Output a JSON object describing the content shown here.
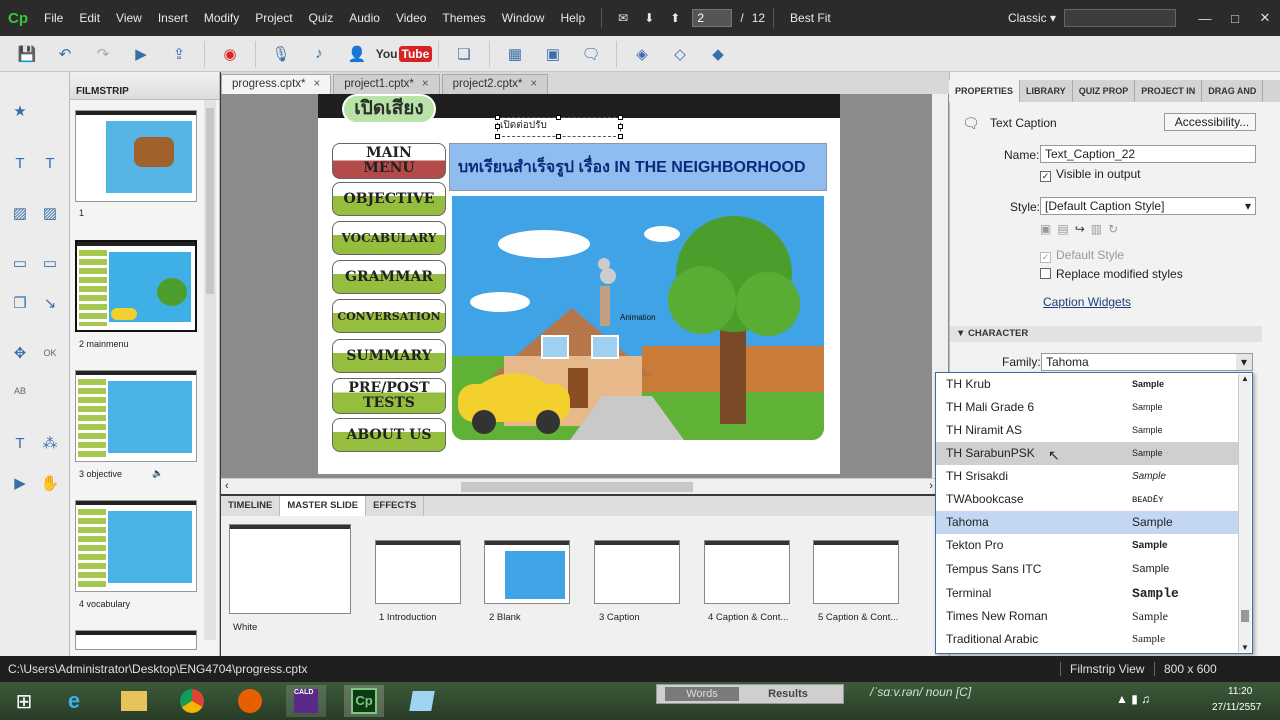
{
  "menubar": {
    "logo": "Cp",
    "items": [
      "File",
      "Edit",
      "View",
      "Insert",
      "Modify",
      "Project",
      "Quiz",
      "Audio",
      "Video",
      "Themes",
      "Window",
      "Help"
    ],
    "current_slide": "2",
    "total_slides": "12",
    "zoom": "Best Fit",
    "workspace": "Classic"
  },
  "tabs": [
    {
      "label": "progress.cptx*"
    },
    {
      "label": "project1.cptx*"
    },
    {
      "label": "project2.cptx*"
    }
  ],
  "filmstrip": {
    "title": "FILMSTRIP",
    "slides": [
      {
        "caption": "1"
      },
      {
        "caption": "2 mainmenu"
      },
      {
        "caption": "3 objective"
      },
      {
        "caption": "4 vocabulary"
      }
    ]
  },
  "slide": {
    "open_sound": "เปิดเสียง",
    "caption_text": "เปิดต่อปรับ",
    "title": "บทเรียนสำเร็จรูป เรื่อง IN THE NEIGHBORHOOD",
    "menu": [
      "MAIN MENU",
      "OBJECTIVE",
      "VOCABULARY",
      "GRAMMAR",
      "CONVERSATION",
      "SUMMARY",
      "PRE/POST TESTS",
      "ABOUT US"
    ],
    "animation_label": "Animation"
  },
  "bottom_panel": {
    "tabs": [
      "TIMELINE",
      "MASTER SLIDE",
      "EFFECTS"
    ],
    "masters": [
      {
        "caption": "White"
      },
      {
        "caption": "1 Introduction"
      },
      {
        "caption": "2 Blank"
      },
      {
        "caption": "3 Caption"
      },
      {
        "caption": "4 Caption & Cont..."
      },
      {
        "caption": "5 Caption & Cont..."
      }
    ]
  },
  "properties": {
    "tabs": [
      "PROPERTIES",
      "LIBRARY",
      "QUIZ PROP",
      "PROJECT IN",
      "DRAG AND"
    ],
    "object_type": "Text Caption",
    "accessibility_button": "Accessibility...",
    "name_label": "Name:",
    "name_value": "Text_Caption_22",
    "visible_label": "Visible in output",
    "style_label": "Style:",
    "style_value": "[Default Caption Style]",
    "default_style_label": "Default Style",
    "replace_label": "Replace modified styles",
    "caption_widgets": "Caption Widgets",
    "character_header": "CHARACTER",
    "family_label": "Family:",
    "family_value": "Tahoma"
  },
  "font_list": [
    {
      "name": "TH Krub",
      "sample": "Sample"
    },
    {
      "name": "TH Mali Grade 6",
      "sample": "Sample"
    },
    {
      "name": "TH Niramit AS",
      "sample": "Sample"
    },
    {
      "name": "TH SarabunPSK",
      "sample": "Sample"
    },
    {
      "name": "TH Srisakdi",
      "sample": "Sample"
    },
    {
      "name": "TWAbookcase",
      "sample": "ʙᴇᴀᴅ£ʏ"
    },
    {
      "name": "Tahoma",
      "sample": "Sample"
    },
    {
      "name": "Tekton Pro",
      "sample": "Sample"
    },
    {
      "name": "Tempus Sans ITC",
      "sample": "Sample"
    },
    {
      "name": "Terminal",
      "sample": "Sample"
    },
    {
      "name": "Times New Roman",
      "sample": "Sample"
    },
    {
      "name": "Traditional Arabic",
      "sample": "Sample"
    }
  ],
  "statusbar": {
    "path": "C:\\Users\\Administrator\\Desktop\\ENG4704\\progress.cptx",
    "view": "Filmstrip View",
    "size": "800 x 600"
  },
  "taskbar": {
    "words_tab": "Words",
    "results_tab": "Results",
    "dict_text": "/ˈsɑːv.rən/ noun [C]",
    "time": "11:20",
    "date": "27/11/2557"
  },
  "colors": {
    "menu_bg": "#2b2b2b",
    "menu_btn_green": "#96be3e",
    "title_blue": "#8fbdf0",
    "scene_sky": "#3fa3e5",
    "selection": "#c3d7f5"
  }
}
